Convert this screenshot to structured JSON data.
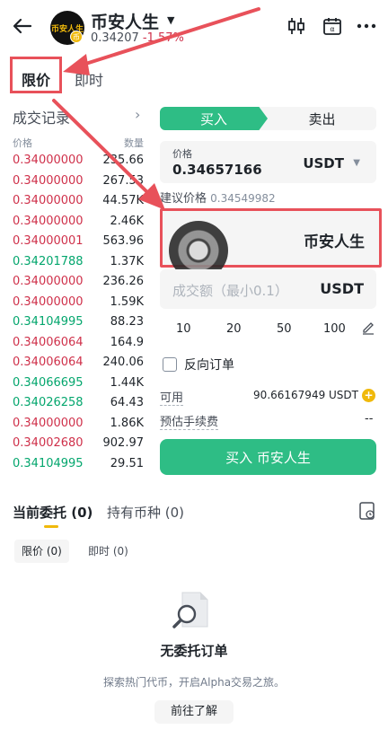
{
  "header": {
    "title": "币安人生",
    "price": "0.34207",
    "change": "-1.57%",
    "logo_text": "币安人生",
    "icons": [
      "back-arrow-icon",
      "candlestick-icon",
      "calendar-icon",
      "more-icon"
    ]
  },
  "order_type_tabs": {
    "limit": "限价",
    "market": "即时"
  },
  "trades": {
    "title": "成交记录",
    "col_price": "价格",
    "col_qty": "数量",
    "rows": [
      {
        "price": "0.34000000",
        "qty": "235.66",
        "side": "sell"
      },
      {
        "price": "0.34000000",
        "qty": "267.53",
        "side": "sell"
      },
      {
        "price": "0.34000000",
        "qty": "44.57K",
        "side": "sell"
      },
      {
        "price": "0.34000000",
        "qty": "2.46K",
        "side": "sell"
      },
      {
        "price": "0.34000001",
        "qty": "563.96",
        "side": "sell"
      },
      {
        "price": "0.34201788",
        "qty": "1.37K",
        "side": "buy"
      },
      {
        "price": "0.34000000",
        "qty": "236.26",
        "side": "sell"
      },
      {
        "price": "0.34000000",
        "qty": "1.59K",
        "side": "sell"
      },
      {
        "price": "0.34104995",
        "qty": "88.23",
        "side": "buy"
      },
      {
        "price": "0.34006064",
        "qty": "164.9",
        "side": "sell"
      },
      {
        "price": "0.34006064",
        "qty": "240.06",
        "side": "sell"
      },
      {
        "price": "0.34066695",
        "qty": "1.44K",
        "side": "buy"
      },
      {
        "price": "0.34026258",
        "qty": "64.43",
        "side": "buy"
      },
      {
        "price": "0.34000000",
        "qty": "1.86K",
        "side": "sell"
      },
      {
        "price": "0.34002680",
        "qty": "902.97",
        "side": "sell"
      },
      {
        "price": "0.34104995",
        "qty": "29.51",
        "side": "buy"
      }
    ]
  },
  "order_form": {
    "buy_tab": "买入",
    "sell_tab": "卖出",
    "price_label": "价格",
    "price_value": "0.34657166",
    "price_unit": "USDT",
    "suggest_label": "建议价格",
    "suggest_value": "0.34549982",
    "amount_unit": "币安人生",
    "total_placeholder": "成交额（最小0.1）",
    "total_unit": "USDT",
    "quick_amounts": [
      "10",
      "20",
      "50",
      "100"
    ],
    "reverse_order": "反向订单",
    "available_label": "可用",
    "available_value": "90.66167949 USDT",
    "fee_label": "预估手续费",
    "fee_value": "--",
    "submit": "买入 币安人生"
  },
  "orders": {
    "tab_open": "当前委托 (0)",
    "tab_holdings": "持有币种 (0)",
    "chip_limit": "限价 (0)",
    "chip_market": "即时 (0)",
    "empty_title": "无委托订单",
    "empty_desc": "探索热门代币，开启Alpha交易之旅。",
    "learn_button": "前往了解"
  },
  "colors": {
    "buy": "#2ebd85",
    "sell": "#cf304a",
    "accent": "#f0b90b",
    "annotation": "#e8515a"
  }
}
